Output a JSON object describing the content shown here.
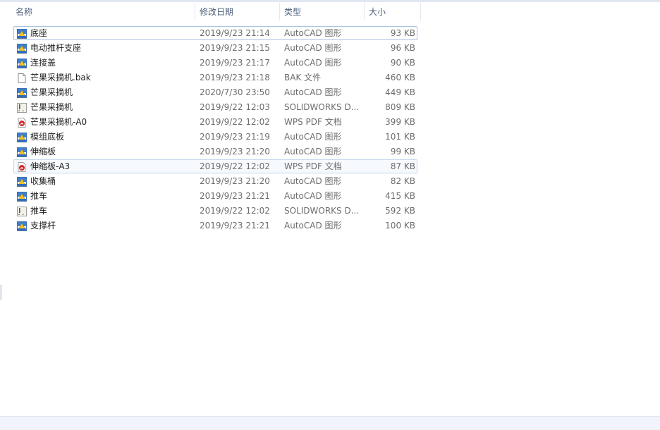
{
  "columns": {
    "name": "名称",
    "date": "修改日期",
    "type": "类型",
    "size": "大小"
  },
  "files": [
    {
      "name": "底座",
      "date": "2019/9/23 21:14",
      "type": "AutoCAD 图形",
      "size": "93 KB",
      "icon": "autocad-drawing-icon"
    },
    {
      "name": "电动推杆支座",
      "date": "2019/9/23 21:15",
      "type": "AutoCAD 图形",
      "size": "96 KB",
      "icon": "autocad-drawing-icon"
    },
    {
      "name": "连接盖",
      "date": "2019/9/23 21:17",
      "type": "AutoCAD 图形",
      "size": "90 KB",
      "icon": "autocad-drawing-icon"
    },
    {
      "name": "芒果采摘机.bak",
      "date": "2019/9/23 21:18",
      "type": "BAK 文件",
      "size": "460 KB",
      "icon": "blank-file-icon"
    },
    {
      "name": "芒果采摘机",
      "date": "2020/7/30 23:50",
      "type": "AutoCAD 图形",
      "size": "449 KB",
      "icon": "autocad-drawing-icon"
    },
    {
      "name": "芒果采摘机",
      "date": "2019/9/22 12:03",
      "type": "SOLIDWORKS D...",
      "size": "809 KB",
      "icon": "solidworks-drawing-icon"
    },
    {
      "name": "芒果采摘机-A0",
      "date": "2019/9/22 12:02",
      "type": "WPS PDF 文档",
      "size": "399 KB",
      "icon": "pdf-document-icon"
    },
    {
      "name": "模组底板",
      "date": "2019/9/23 21:19",
      "type": "AutoCAD 图形",
      "size": "101 KB",
      "icon": "autocad-drawing-icon"
    },
    {
      "name": "伸缩板",
      "date": "2019/9/23 21:20",
      "type": "AutoCAD 图形",
      "size": "99 KB",
      "icon": "autocad-drawing-icon"
    },
    {
      "name": "伸缩板-A3",
      "date": "2019/9/22 12:02",
      "type": "WPS PDF 文档",
      "size": "87 KB",
      "icon": "pdf-document-icon"
    },
    {
      "name": "收集桶",
      "date": "2019/9/23 21:20",
      "type": "AutoCAD 图形",
      "size": "82 KB",
      "icon": "autocad-drawing-icon"
    },
    {
      "name": "推车",
      "date": "2019/9/23 21:21",
      "type": "AutoCAD 图形",
      "size": "415 KB",
      "icon": "autocad-drawing-icon"
    },
    {
      "name": "推车",
      "date": "2019/9/22 12:02",
      "type": "SOLIDWORKS D...",
      "size": "592 KB",
      "icon": "solidworks-drawing-icon"
    },
    {
      "name": "支撑杆",
      "date": "2019/9/23 21:21",
      "type": "AutoCAD 图形",
      "size": "100 KB",
      "icon": "autocad-drawing-icon"
    }
  ],
  "colors": {
    "header_text": "#4c607a",
    "focus_border": "#a9c2e0",
    "hover_border": "#c6d8ee",
    "pdf_red": "#d7262a",
    "autocad_yellow": "#f3c523",
    "autocad_blue": "#2f6bc4"
  }
}
